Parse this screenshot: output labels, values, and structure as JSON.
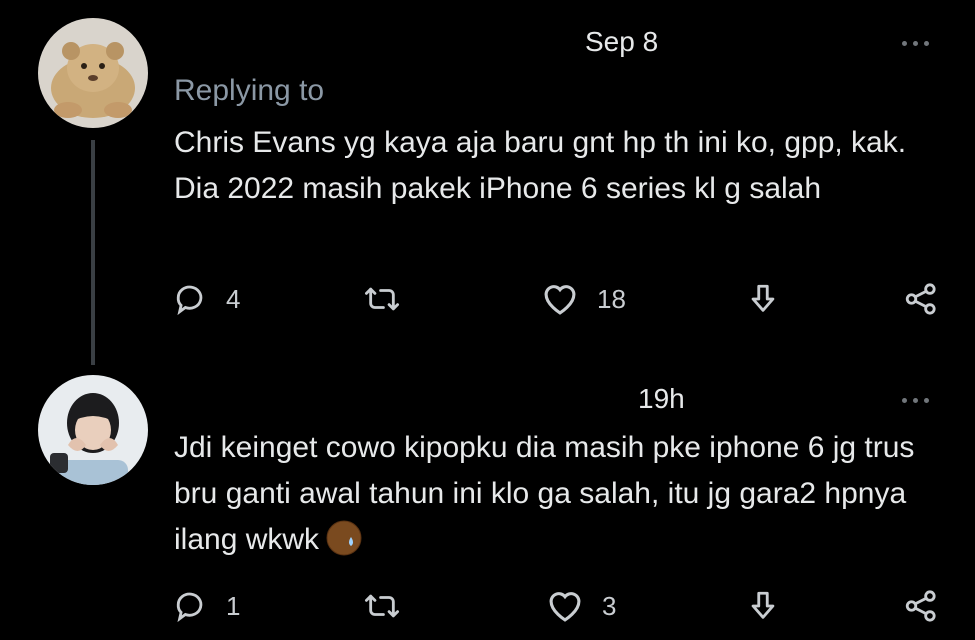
{
  "tweets": [
    {
      "time": "Sep 8",
      "replying_label": "Replying to",
      "text": "Chris Evans yg kaya aja baru gnt hp th ini ko, gpp, kak. Dia 2022 masih pakek iPhone 6 series kl g salah",
      "replies": "4",
      "likes": "18",
      "avatar_icon": "lion-cub-photo"
    },
    {
      "time": "19h",
      "text": "Jdi keinget cowo kipopku dia masih pke iphone 6 jg trus bru ganti awal tahun ini klo ga salah, itu jg gara2 hpnya ilang wkwk",
      "emoji": "sweat-emoji",
      "replies": "1",
      "likes": "3",
      "avatar_icon": "person-heart-hands-photo"
    }
  ],
  "colors": {
    "background": "#000000",
    "text": "#e7e9ea",
    "muted": "#8b98a5",
    "thread_line": "#3a3f44"
  }
}
